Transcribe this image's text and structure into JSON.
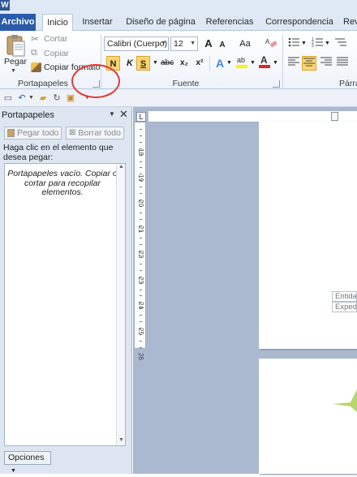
{
  "app": {
    "icon_letter": "W"
  },
  "tabs": [
    {
      "label": "Archivo"
    },
    {
      "label": "Inicio"
    },
    {
      "label": "Insertar"
    },
    {
      "label": "Diseño de página"
    },
    {
      "label": "Referencias"
    },
    {
      "label": "Correspondencia"
    },
    {
      "label": "Rev"
    }
  ],
  "clipboard_group": {
    "paste_label": "Pegar",
    "cut_label": "Cortar",
    "copy_label": "Copiar",
    "format_painter_label": "Copiar formato",
    "group_label": "Portapapeles"
  },
  "font_group": {
    "font_name": "Calibri (Cuerpo)",
    "font_size": "12",
    "bold_label": "N",
    "italic_label": "K",
    "underline_label": "S",
    "strike_label": "abc",
    "subscript_label": "x₂",
    "superscript_label": "x²",
    "grow_label": "A",
    "shrink_label": "A",
    "case_label": "Aa",
    "group_label": "Fuente"
  },
  "paragraph_group": {
    "group_label": "Párra"
  },
  "task_pane": {
    "title": "Portapapeles",
    "paste_all_label": "Pegar todo",
    "clear_all_label": "Borrar todo",
    "instruction": "Haga clic en el elemento que desea pegar:",
    "empty_message": "Portapapeles vacío. Copiar o cortar para recopilar elementos.",
    "options_label": "Opciones"
  },
  "ruler": {
    "numbers": [
      "18",
      "19",
      "20",
      "21",
      "22",
      "23",
      "24",
      "25",
      "26"
    ]
  },
  "document": {
    "field_1": "Entida",
    "field_2": "Expedi"
  },
  "colors": {
    "accent": "#2a5ba8",
    "ribbon_bg": "#dfe9f5",
    "highlight": "#fbd66f",
    "annotation": "#e03a3a"
  }
}
